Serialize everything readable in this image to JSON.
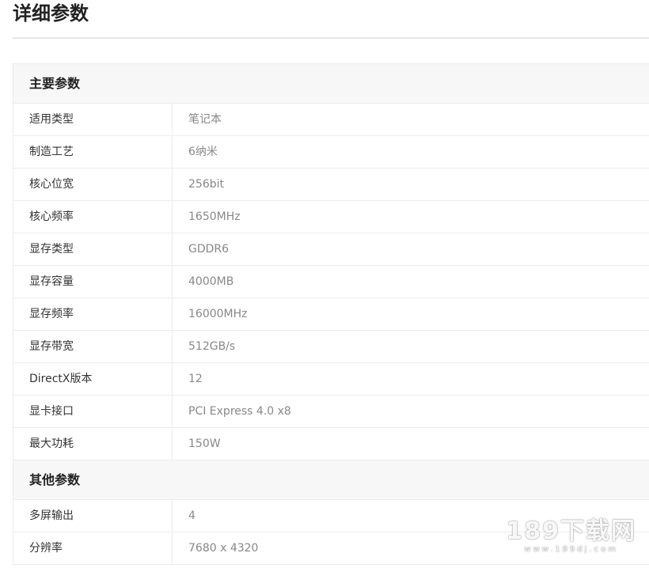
{
  "page": {
    "title": "详细参数"
  },
  "sections": [
    {
      "title": "主要参数",
      "rows": [
        {
          "label": "适用类型",
          "value": "笔记本"
        },
        {
          "label": "制造工艺",
          "value": "6纳米"
        },
        {
          "label": "核心位宽",
          "value": "256bit"
        },
        {
          "label": "核心频率",
          "value": "1650MHz"
        },
        {
          "label": "显存类型",
          "value": "GDDR6"
        },
        {
          "label": "显存容量",
          "value": "4000MB"
        },
        {
          "label": "显存频率",
          "value": "16000MHz"
        },
        {
          "label": "显存带宽",
          "value": "512GB/s"
        },
        {
          "label": "DirectX版本",
          "value": "12"
        },
        {
          "label": "显卡接口",
          "value": "PCI Express 4.0 x8"
        },
        {
          "label": "最大功耗",
          "value": "150W"
        }
      ]
    },
    {
      "title": "其他参数",
      "rows": [
        {
          "label": "多屏输出",
          "value": "4"
        },
        {
          "label": "分辨率",
          "value": "7680 x 4320"
        }
      ]
    }
  ],
  "watermark": {
    "main": "189下载网",
    "sub": "www.189dj.com"
  },
  "colors": {
    "header_bg": "#f7f7f7",
    "border": "#ececec",
    "label_text": "#333333",
    "value_text": "#888888"
  }
}
